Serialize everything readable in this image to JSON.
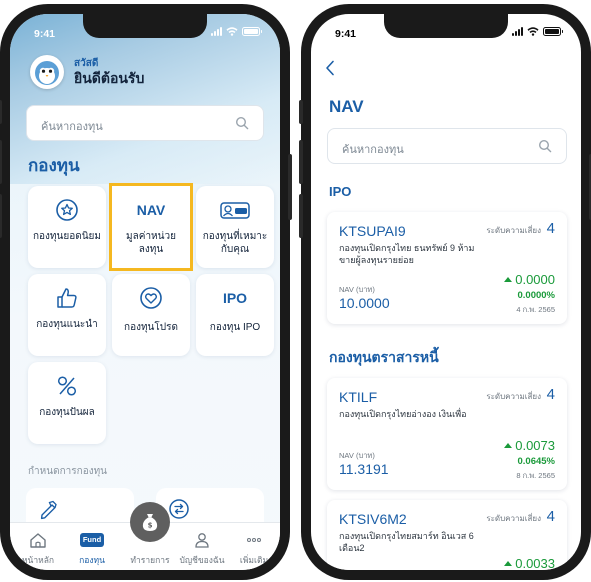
{
  "left_screen": {
    "status": {
      "time": "9:41"
    },
    "greeting": {
      "small": "สวัสดี",
      "big": "ยินดีต้อนรับ"
    },
    "search": {
      "placeholder": "ค้นหากองทุน"
    },
    "section_title": "กองทุน",
    "tiles": [
      {
        "label": "กองทุนยอดนิยม",
        "icon": "star-badge-icon"
      },
      {
        "icon_text": "NAV",
        "label": "มูลค่าหน่วยลงทุน"
      },
      {
        "label": "กองทุนที่เหมาะกับคุณ",
        "icon": "fund-card-icon"
      },
      {
        "label": "กองทุนแนะนำ",
        "icon": "thumbs-up-icon"
      },
      {
        "label": "กองทุนโปรด",
        "icon": "heart-icon"
      },
      {
        "icon_text": "IPO",
        "label": "กองทุน IPO"
      },
      {
        "label": "กองทุนปันผล",
        "icon": "percent-icon"
      }
    ],
    "sub_section": "กำหนดการกองทุน",
    "tabs": [
      {
        "label": "หน้าหลัก",
        "icon": "home-icon"
      },
      {
        "label": "กองทุน",
        "icon": "fund-icon",
        "icon_text": "Fund"
      },
      {
        "label": "ทำรายการ",
        "icon": "money-bag-icon"
      },
      {
        "label": "บัญชีของฉัน",
        "icon": "user-icon"
      },
      {
        "label": "เพิ่มเติม",
        "icon": "more-icon"
      }
    ],
    "highlight_color": "#f5b820"
  },
  "right_screen": {
    "status": {
      "time": "9:41"
    },
    "title": "NAV",
    "search": {
      "placeholder": "ค้นหากองทุน"
    },
    "sections": [
      {
        "title": "IPO",
        "funds": [
          {
            "name": "KTSUPAI9",
            "risk_label": "ระดับความเสี่ยง",
            "risk_level": "4",
            "desc": "กองทุนเปิดกรุงไทย ธนทรัพย์ 9 ห้ามขายผู้ลงทุนรายย่อย",
            "nav_label": "NAV (บาท)",
            "nav": "10.0000",
            "change": "0.0000",
            "change_pct": "0.0000%",
            "date": "4 ก.พ. 2565"
          }
        ]
      },
      {
        "title": "กองทุนตราสารหนี้",
        "funds": [
          {
            "name": "KTILF",
            "risk_label": "ระดับความเสี่ยง",
            "risk_level": "4",
            "desc": "กองทุนเปิดกรุงไทยอ่างอง เงินเพื่อ",
            "nav_label": "NAV (บาท)",
            "nav": "11.3191",
            "change": "0.0073",
            "change_pct": "0.0645%",
            "date": "8 ก.พ. 2565"
          },
          {
            "name": "KTSIV6M2",
            "risk_label": "ระดับความเสี่ยง",
            "risk_level": "4",
            "desc": "กองทุนเปิดกรุงไทยสมาร์ท อินเวส 6 เดือน2",
            "change": "0.0033"
          }
        ]
      }
    ],
    "colors": {
      "accent": "#1b5ea6",
      "positive": "#1a9a3a"
    }
  }
}
